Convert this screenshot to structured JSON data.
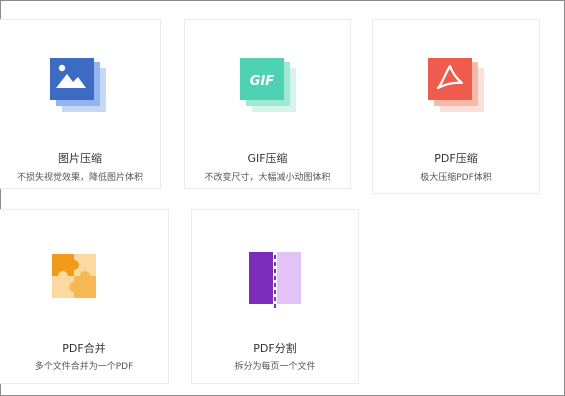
{
  "tools": [
    {
      "title": "图片压缩",
      "desc": "不损失视觉效果，降低图片体积",
      "icon": "image-compress-icon",
      "color": "#3d6bc4"
    },
    {
      "title": "GIF压缩",
      "desc": "不改变尺寸，大幅减小动图体积",
      "icon": "gif-compress-icon",
      "glyph": "GIF",
      "color": "#4fd1b4"
    },
    {
      "title": "PDF压缩",
      "desc": "极大压缩PDF体积",
      "icon": "pdf-compress-icon",
      "color": "#ef5b4c"
    },
    {
      "title": "PDF合并",
      "desc": "多个文件合并为一个PDF",
      "icon": "pdf-merge-icon",
      "color": "#f6a623"
    },
    {
      "title": "PDF分割",
      "desc": "拆分为每页一个文件",
      "icon": "pdf-split-icon",
      "color": "#7b2dba"
    }
  ]
}
